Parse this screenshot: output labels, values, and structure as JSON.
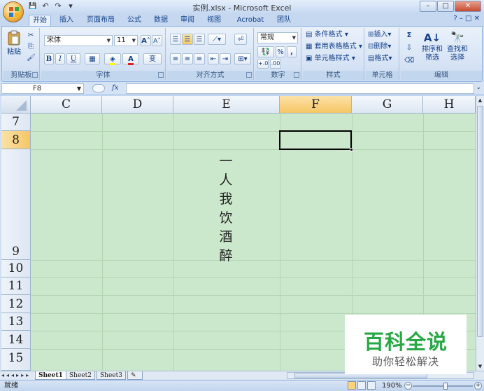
{
  "window": {
    "title": "实例.xlsx - Microsoft Excel",
    "minimize_label": "–",
    "maximize_label": "□",
    "close_label": "✕"
  },
  "quick_access": {
    "save": "💾",
    "undo": "↶",
    "redo": "↷",
    "more": "▾"
  },
  "ribbon_tabs": [
    {
      "label": "开始",
      "active": true
    },
    {
      "label": "插入"
    },
    {
      "label": "页面布局"
    },
    {
      "label": "公式"
    },
    {
      "label": "数据"
    },
    {
      "label": "审阅"
    },
    {
      "label": "视图"
    },
    {
      "label": "Acrobat"
    },
    {
      "label": "团队"
    }
  ],
  "ribbon_right": "? – □ ✕",
  "ribbon": {
    "clipboard": {
      "label": "剪贴板",
      "paste": "粘贴"
    },
    "font": {
      "label": "字体",
      "font_name": "宋体",
      "font_size": "11",
      "bold": "B",
      "italic": "I",
      "underline": "U",
      "grow": "A˄",
      "shrink": "A˅",
      "wen": "变"
    },
    "alignment": {
      "label": "对齐方式"
    },
    "number": {
      "label": "数字",
      "format": "常规",
      "percent": "%",
      "comma": ","
    },
    "styles": {
      "label": "样式",
      "cond": "条件格式",
      "table": "套用表格格式",
      "cell": "单元格样式"
    },
    "cells": {
      "label": "单元格",
      "insert": "插入",
      "delete": "删除",
      "format": "格式"
    },
    "editing": {
      "label": "编辑",
      "sigma": "Σ",
      "sort": "排序和",
      "sort2": "筛选",
      "find": "查找和",
      "find2": "选择"
    }
  },
  "formula_bar": {
    "name_box": "F8",
    "fx": "fx",
    "content": ""
  },
  "columns": [
    "C",
    "D",
    "E",
    "F",
    "G",
    "H"
  ],
  "selected_column": "F",
  "rows": [
    "7",
    "8",
    "9",
    "10",
    "11",
    "12",
    "13",
    "14",
    "15"
  ],
  "selected_row": "8",
  "active_cell": "F8",
  "cell_content": {
    "cell": "E9",
    "chars": [
      "一",
      "人",
      "我",
      "饮",
      "酒",
      "醉"
    ]
  },
  "sheets": [
    {
      "label": "Sheet1",
      "active": true
    },
    {
      "label": "Sheet2"
    },
    {
      "label": "Sheet3"
    }
  ],
  "status": {
    "text": "就绪",
    "zoom": "190%"
  },
  "colors": {
    "sheet_bg": "#cce8cc",
    "accent": "#f6c665",
    "watermark": "#27a844"
  },
  "watermark": {
    "title": "百科全说",
    "subtitle": "助你轻松解决"
  }
}
